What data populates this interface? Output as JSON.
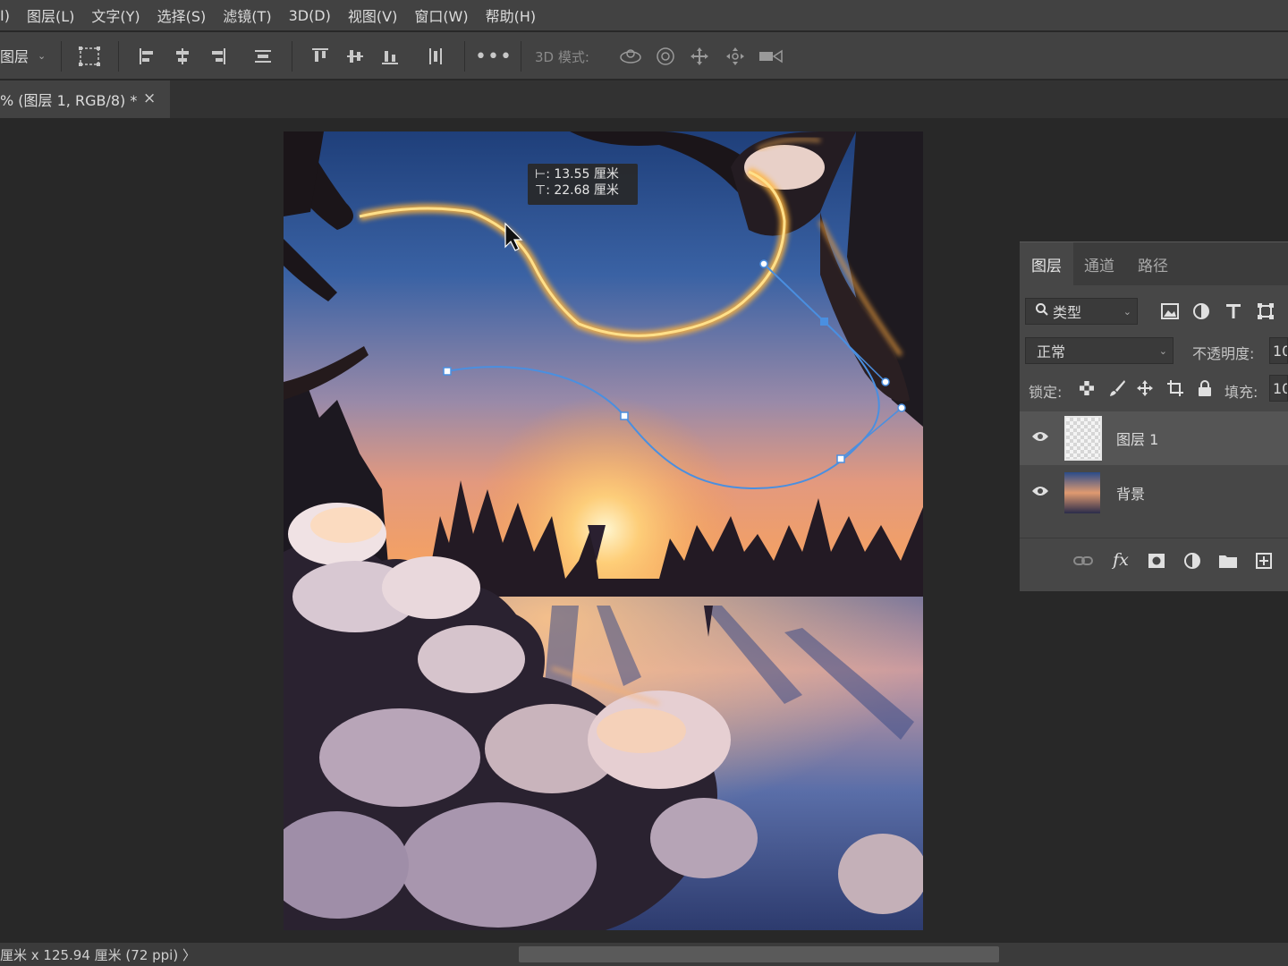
{
  "menu": [
    "I)",
    "图层(L)",
    "文字(Y)",
    "选择(S)",
    "滤镜(T)",
    "3D(D)",
    "视图(V)",
    "窗口(W)",
    "帮助(H)"
  ],
  "options_bar": {
    "layer_select": "图层",
    "mode_3d_label": "3D 模式:"
  },
  "document_tab": {
    "title": "% (图层 1, RGB/8) *",
    "close": "×"
  },
  "tooltip": {
    "x_line": "⊢: 13.55 厘米",
    "y_line": "⊤: 22.68 厘米"
  },
  "layers_panel": {
    "tabs": [
      "图层",
      "通道",
      "路径"
    ],
    "filter_kind": "类型",
    "blend_mode": "正常",
    "opacity_label": "不透明度:",
    "opacity_value": "10",
    "lock_label": "锁定:",
    "fill_label": "填充:",
    "fill_value": "10",
    "layers": [
      {
        "name": "图层 1",
        "selected": true,
        "visible": true
      },
      {
        "name": "背景",
        "selected": false,
        "visible": true
      }
    ]
  },
  "status": {
    "text": "厘米 x 125.94 厘米 (72 ppi)  〉"
  },
  "colors": {
    "ui_dark": "#282828",
    "ui_panel": "#424242",
    "path_blue": "#4a8fe0",
    "glow_gold": "#ffb43a"
  }
}
